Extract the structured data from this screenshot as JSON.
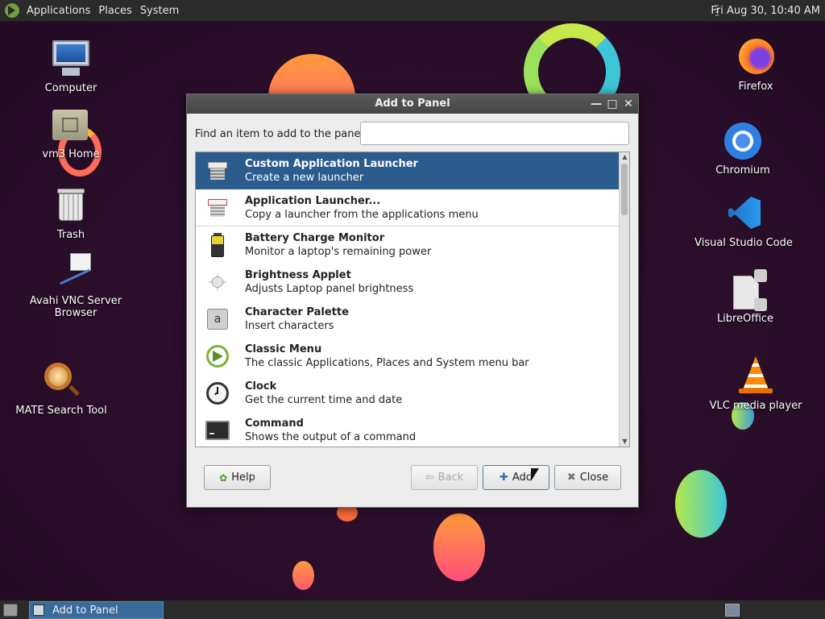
{
  "top_panel": {
    "menus": [
      "Applications",
      "Places",
      "System"
    ],
    "clock": "Fri Aug 30, 10:40 AM"
  },
  "desktop_icons_left": [
    {
      "label": "Computer",
      "icon": "computer-icon"
    },
    {
      "label": "vm3 Home",
      "icon": "home-folder-icon"
    },
    {
      "label": "Trash",
      "icon": "trash-icon"
    },
    {
      "label": "Avahi VNC Server Browser",
      "icon": "network-icon"
    },
    {
      "label": "MATE Search Tool",
      "icon": "search-tool-icon"
    }
  ],
  "desktop_icons_right": [
    {
      "label": "Firefox",
      "icon": "firefox-icon"
    },
    {
      "label": "Chromium",
      "icon": "chromium-icon"
    },
    {
      "label": "Visual Studio Code",
      "icon": "vscode-icon"
    },
    {
      "label": "LibreOffice",
      "icon": "libreoffice-icon"
    },
    {
      "label": "VLC media player",
      "icon": "vlc-icon"
    }
  ],
  "dialog": {
    "title": "Add to Panel",
    "find_label": "Find an item to add to the panel:",
    "find_value": "",
    "items": [
      {
        "name": "Custom Application Launcher",
        "desc": "Create a new launcher",
        "icon": "launcher-icon",
        "selected": true
      },
      {
        "name": "Application Launcher...",
        "desc": "Copy a launcher from the applications menu",
        "icon": "launcher-icon"
      },
      {
        "name": "Battery Charge Monitor",
        "desc": "Monitor a laptop's remaining power",
        "icon": "battery-icon"
      },
      {
        "name": "Brightness Applet",
        "desc": "Adjusts Laptop panel brightness",
        "icon": "brightness-icon"
      },
      {
        "name": "Character Palette",
        "desc": "Insert characters",
        "icon": "character-palette-icon"
      },
      {
        "name": "Classic Menu",
        "desc": "The classic Applications, Places and System menu bar",
        "icon": "classic-menu-icon"
      },
      {
        "name": "Clock",
        "desc": "Get the current time and date",
        "icon": "clock-icon"
      },
      {
        "name": "Command",
        "desc": "Shows the output of a command",
        "icon": "terminal-icon"
      }
    ],
    "buttons": {
      "help": "Help",
      "back": "Back",
      "add": "Add",
      "close": "Close"
    }
  },
  "taskbar": {
    "window_title": "Add to Panel"
  }
}
